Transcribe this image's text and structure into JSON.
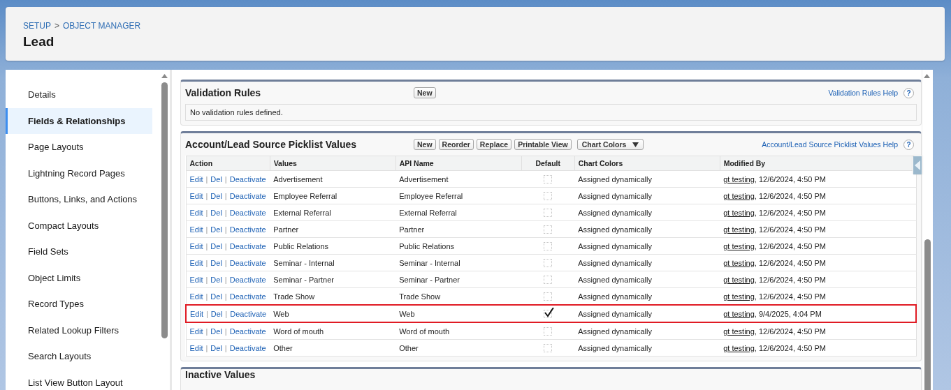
{
  "breadcrumb": [
    "SETUP",
    ">",
    "OBJECT MANAGER"
  ],
  "title": "Lead",
  "sidebar": {
    "items": [
      {
        "label": "Details",
        "selected": false
      },
      {
        "label": "Fields & Relationships",
        "selected": true
      },
      {
        "label": "Page Layouts",
        "selected": false
      },
      {
        "label": "Lightning Record Pages",
        "selected": false
      },
      {
        "label": "Buttons, Links, and Actions",
        "selected": false
      },
      {
        "label": "Compact Layouts",
        "selected": false
      },
      {
        "label": "Field Sets",
        "selected": false
      },
      {
        "label": "Object Limits",
        "selected": false
      },
      {
        "label": "Record Types",
        "selected": false
      },
      {
        "label": "Related Lookup Filters",
        "selected": false
      },
      {
        "label": "Search Layouts",
        "selected": false
      },
      {
        "label": "List View Button Layout",
        "selected": false
      }
    ]
  },
  "validation_rules": {
    "title": "Validation Rules",
    "buttons": [
      "New"
    ],
    "help": "Validation Rules Help",
    "help_icon": "?",
    "message": "No validation rules defined."
  },
  "picklist": {
    "title": "Account/Lead Source Picklist Values",
    "buttons": [
      "New",
      "Reorder",
      "Replace",
      "Printable View"
    ],
    "dropdown": "Chart Colors",
    "help": "Account/Lead Source Picklist Values Help",
    "help_icon": "?",
    "columns": [
      "Action",
      "Values",
      "API Name",
      "Default",
      "Chart Colors",
      "Modified By"
    ],
    "rows": [
      {
        "actions": [
          "Edit",
          "|",
          "Del",
          "|",
          "Deactivate"
        ],
        "value": "Advertisement",
        "api_name": "Advertisement",
        "default": false,
        "chart_color": "Assigned dynamically",
        "modified_user": "gt testing",
        "modified_date": ", 12/6/2024, 4:50 PM",
        "highlighted": false
      },
      {
        "actions": [
          "Edit",
          "|",
          "Del",
          "|",
          "Deactivate"
        ],
        "value": "Employee Referral",
        "api_name": "Employee Referral",
        "default": false,
        "chart_color": "Assigned dynamically",
        "modified_user": "gt testing",
        "modified_date": ", 12/6/2024, 4:50 PM",
        "highlighted": false
      },
      {
        "actions": [
          "Edit",
          "|",
          "Del",
          "|",
          "Deactivate"
        ],
        "value": "External Referral",
        "api_name": "External Referral",
        "default": false,
        "chart_color": "Assigned dynamically",
        "modified_user": "gt testing",
        "modified_date": ", 12/6/2024, 4:50 PM",
        "highlighted": false
      },
      {
        "actions": [
          "Edit",
          "|",
          "Del",
          "|",
          "Deactivate"
        ],
        "value": "Partner",
        "api_name": "Partner",
        "default": false,
        "chart_color": "Assigned dynamically",
        "modified_user": "gt testing",
        "modified_date": ", 12/6/2024, 4:50 PM",
        "highlighted": false
      },
      {
        "actions": [
          "Edit",
          "|",
          "Del",
          "|",
          "Deactivate"
        ],
        "value": "Public Relations",
        "api_name": "Public Relations",
        "default": false,
        "chart_color": "Assigned dynamically",
        "modified_user": "gt testing",
        "modified_date": ", 12/6/2024, 4:50 PM",
        "highlighted": false
      },
      {
        "actions": [
          "Edit",
          "|",
          "Del",
          "|",
          "Deactivate"
        ],
        "value": "Seminar - Internal",
        "api_name": "Seminar - Internal",
        "default": false,
        "chart_color": "Assigned dynamically",
        "modified_user": "gt testing",
        "modified_date": ", 12/6/2024, 4:50 PM",
        "highlighted": false
      },
      {
        "actions": [
          "Edit",
          "|",
          "Del",
          "|",
          "Deactivate"
        ],
        "value": "Seminar - Partner",
        "api_name": "Seminar - Partner",
        "default": false,
        "chart_color": "Assigned dynamically",
        "modified_user": "gt testing",
        "modified_date": ", 12/6/2024, 4:50 PM",
        "highlighted": false
      },
      {
        "actions": [
          "Edit",
          "|",
          "Del",
          "|",
          "Deactivate"
        ],
        "value": "Trade Show",
        "api_name": "Trade Show",
        "default": false,
        "chart_color": "Assigned dynamically",
        "modified_user": "gt testing",
        "modified_date": ", 12/6/2024, 4:50 PM",
        "highlighted": false
      },
      {
        "actions": [
          "Edit",
          "|",
          "Del",
          "|",
          "Deactivate"
        ],
        "value": "Web",
        "api_name": "Web",
        "default": true,
        "chart_color": "Assigned dynamically",
        "modified_user": "gt testing",
        "modified_date": ", 9/4/2025, 4:04 PM",
        "highlighted": true
      },
      {
        "actions": [
          "Edit",
          "|",
          "Del",
          "|",
          "Deactivate"
        ],
        "value": "Word of mouth",
        "api_name": "Word of mouth",
        "default": false,
        "chart_color": "Assigned dynamically",
        "modified_user": "gt testing",
        "modified_date": ", 12/6/2024, 4:50 PM",
        "highlighted": false
      },
      {
        "actions": [
          "Edit",
          "|",
          "Del",
          "|",
          "Deactivate"
        ],
        "value": "Other",
        "api_name": "Other",
        "default": false,
        "chart_color": "Assigned dynamically",
        "modified_user": "gt testing",
        "modified_date": ", 12/6/2024, 4:50 PM",
        "highlighted": false
      }
    ]
  },
  "inactive_values": {
    "title": "Inactive Values"
  }
}
